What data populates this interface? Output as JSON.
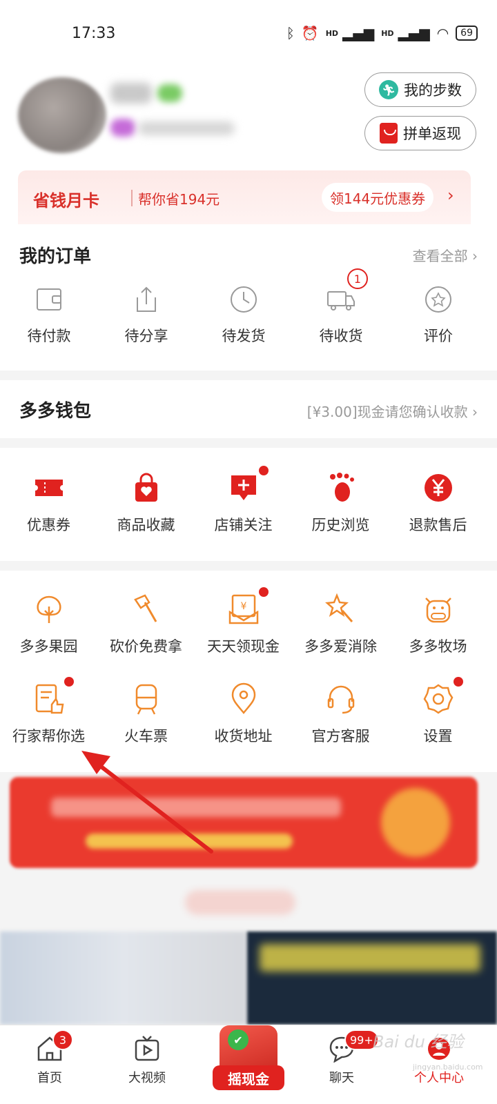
{
  "status_bar": {
    "time": "17:33",
    "battery": "69",
    "hd1": "HD",
    "hd2": "HD"
  },
  "profile": {
    "steps_button": "我的步数",
    "groupbuy_button": "拼单返现"
  },
  "month_card": {
    "title": "省钱月卡",
    "subtitle": "帮你省194元",
    "coupon": "领144元优惠券",
    "arrow": "›"
  },
  "orders": {
    "title": "我的订单",
    "view_all": "查看全部 ›",
    "items": [
      {
        "label": "待付款",
        "icon": "wallet-icon"
      },
      {
        "label": "待分享",
        "icon": "share-icon"
      },
      {
        "label": "待发货",
        "icon": "clock-icon"
      },
      {
        "label": "待收货",
        "icon": "truck-icon",
        "badge": "1"
      },
      {
        "label": "评价",
        "icon": "star-icon"
      }
    ]
  },
  "wallet": {
    "title": "多多钱包",
    "note": "[¥3.00]现金请您确认收款 ›"
  },
  "services": {
    "items": [
      {
        "label": "优惠券",
        "icon": "coupon-icon"
      },
      {
        "label": "商品收藏",
        "icon": "bag-heart-icon"
      },
      {
        "label": "店铺关注",
        "icon": "store-follow-icon",
        "dot": true
      },
      {
        "label": "历史浏览",
        "icon": "footprint-icon"
      },
      {
        "label": "退款售后",
        "icon": "yuan-refund-icon"
      }
    ]
  },
  "tools": {
    "row1": [
      {
        "label": "多多果园",
        "icon": "tree-icon"
      },
      {
        "label": "砍价免费拿",
        "icon": "axe-icon"
      },
      {
        "label": "天天领现金",
        "icon": "cash-envelope-icon",
        "dot": true
      },
      {
        "label": "多多爱消除",
        "icon": "star-wand-icon"
      },
      {
        "label": "多多牧场",
        "icon": "cow-icon"
      }
    ],
    "row2": [
      {
        "label": "行家帮你选",
        "icon": "expert-pick-icon",
        "dot": true
      },
      {
        "label": "火车票",
        "icon": "train-icon"
      },
      {
        "label": "收货地址",
        "icon": "location-icon"
      },
      {
        "label": "官方客服",
        "icon": "headset-icon"
      },
      {
        "label": "设置",
        "icon": "settings-icon",
        "dot": true
      }
    ]
  },
  "bottom_nav": {
    "items": [
      {
        "label": "首页",
        "icon": "home-icon",
        "badge": "3"
      },
      {
        "label": "大视频",
        "icon": "video-icon"
      },
      {
        "label": "摇现金",
        "icon": "shake-cash-icon"
      },
      {
        "label": "聊天",
        "icon": "chat-icon",
        "badge": "99+"
      },
      {
        "label": "个人中心",
        "icon": "profile-icon"
      }
    ]
  },
  "watermark": {
    "main": "Bai du 经验",
    "sub": "jingyan.baidu.com"
  },
  "colors": {
    "brand_red": "#e0221f",
    "orange_icon": "#f08a2c",
    "muted": "#999999"
  }
}
